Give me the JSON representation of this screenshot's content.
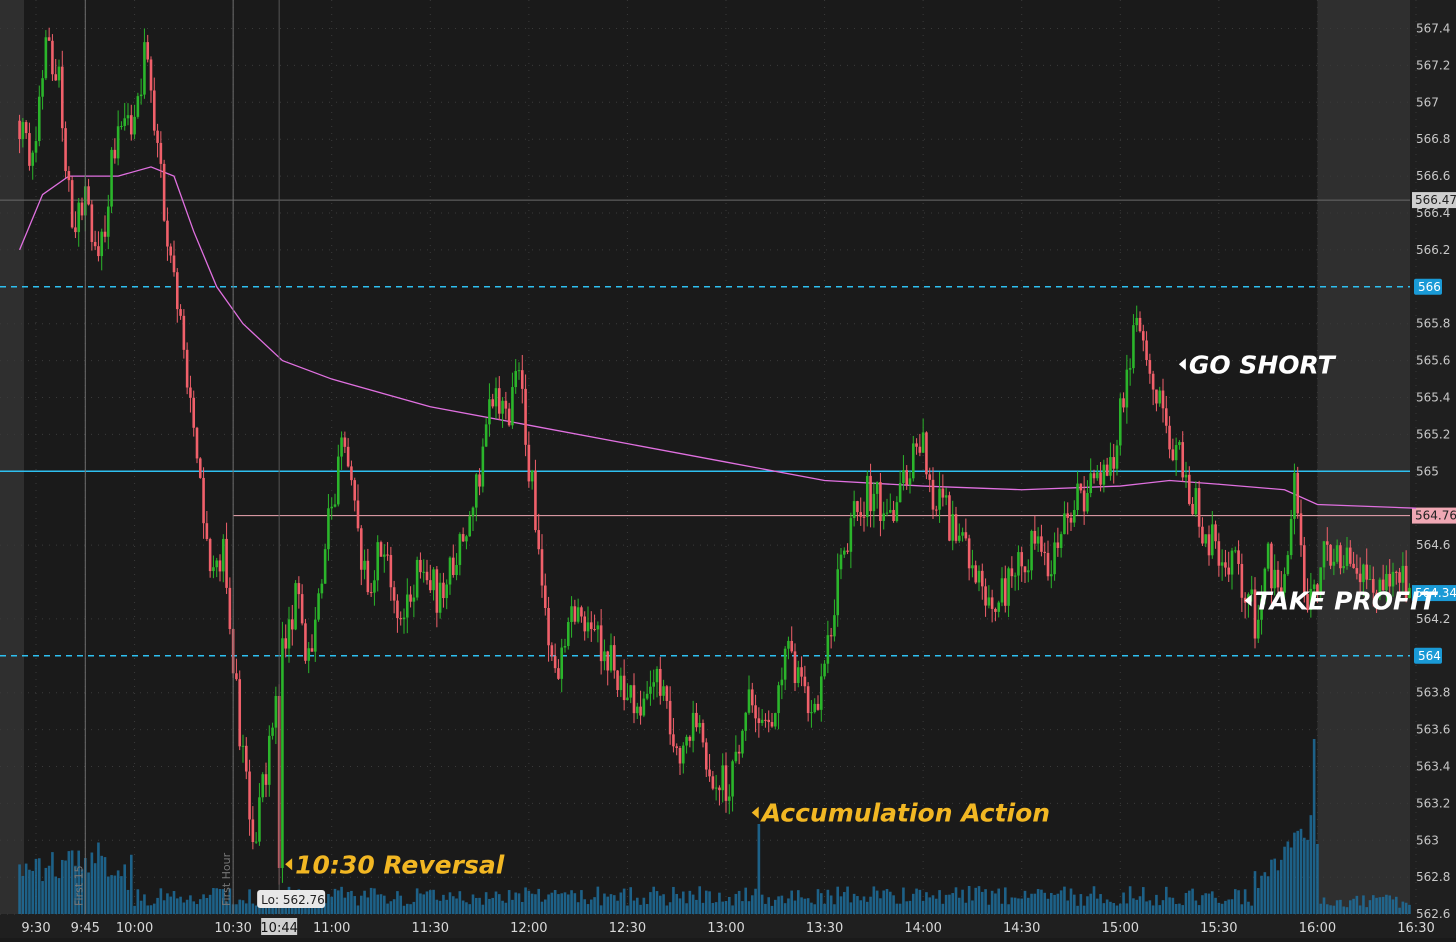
{
  "colors": {
    "background": "#1a1a1a",
    "extended_hours": "#2f2f2f",
    "up_candle": "#2bb52b",
    "down_candle": "#f0606a",
    "volume": "#1e6f9c",
    "vwap": "#e070e0",
    "level_line": "#2ec0f0",
    "annotation_yellow": "#f2b723",
    "annotation_white": "#ffffff",
    "badge_blue": "#1a9ad6",
    "badge_pink": "#f0a8b4",
    "badge_gray": "#cfcfcf"
  },
  "chart_data": {
    "type": "candlestick",
    "x_ticks": [
      "9:30",
      "9:45",
      "10:00",
      "10:30",
      "11:00",
      "11:30",
      "12:00",
      "12:30",
      "13:00",
      "13:30",
      "14:00",
      "14:30",
      "15:00",
      "15:30",
      "16:00",
      "16:30"
    ],
    "y_ticks": [
      "567.4",
      "567.2",
      "567",
      "566.8",
      "566.6",
      "566.4",
      "566.2",
      "565.8",
      "565.6",
      "565.4",
      "565.2",
      "565",
      "564.6",
      "564.2",
      "563.8",
      "563.6",
      "563.4",
      "563.2",
      "563",
      "562.8",
      "562.6"
    ],
    "ylim": [
      562.6,
      567.5
    ],
    "x_range_minutes": [
      560,
      990
    ],
    "session_open": "9:30",
    "session_close": "16:00",
    "price_path": [
      {
        "t": "9:25",
        "p": 566.9
      },
      {
        "t": "9:30",
        "p": 566.7
      },
      {
        "t": "9:34",
        "p": 567.3
      },
      {
        "t": "9:38",
        "p": 567.1
      },
      {
        "t": "9:42",
        "p": 566.3
      },
      {
        "t": "9:46",
        "p": 566.5
      },
      {
        "t": "9:50",
        "p": 566.1
      },
      {
        "t": "9:55",
        "p": 566.8
      },
      {
        "t": "10:00",
        "p": 566.9
      },
      {
        "t": "10:05",
        "p": 567.3
      },
      {
        "t": "10:09",
        "p": 566.6
      },
      {
        "t": "10:14",
        "p": 565.9
      },
      {
        "t": "10:20",
        "p": 565.1
      },
      {
        "t": "10:25",
        "p": 564.4
      },
      {
        "t": "10:28",
        "p": 564.6
      },
      {
        "t": "10:33",
        "p": 563.6
      },
      {
        "t": "10:37",
        "p": 563.0
      },
      {
        "t": "10:41",
        "p": 563.4
      },
      {
        "t": "10:46",
        "p": 564.0
      },
      {
        "t": "10:50",
        "p": 564.3
      },
      {
        "t": "10:54",
        "p": 564.0
      },
      {
        "t": "11:00",
        "p": 564.7
      },
      {
        "t": "11:04",
        "p": 565.1
      },
      {
        "t": "11:08",
        "p": 564.8
      },
      {
        "t": "11:12",
        "p": 564.3
      },
      {
        "t": "11:16",
        "p": 564.6
      },
      {
        "t": "11:22",
        "p": 564.2
      },
      {
        "t": "11:28",
        "p": 564.5
      },
      {
        "t": "11:34",
        "p": 564.3
      },
      {
        "t": "11:40",
        "p": 564.6
      },
      {
        "t": "11:46",
        "p": 565.0
      },
      {
        "t": "11:50",
        "p": 565.4
      },
      {
        "t": "11:54",
        "p": 565.3
      },
      {
        "t": "11:58",
        "p": 565.5
      },
      {
        "t": "12:02",
        "p": 564.9
      },
      {
        "t": "12:06",
        "p": 564.2
      },
      {
        "t": "12:10",
        "p": 563.9
      },
      {
        "t": "12:16",
        "p": 564.3
      },
      {
        "t": "12:22",
        "p": 564.1
      },
      {
        "t": "12:28",
        "p": 563.9
      },
      {
        "t": "12:34",
        "p": 563.7
      },
      {
        "t": "12:40",
        "p": 563.9
      },
      {
        "t": "12:46",
        "p": 563.5
      },
      {
        "t": "12:52",
        "p": 563.6
      },
      {
        "t": "12:56",
        "p": 563.4
      },
      {
        "t": "13:02",
        "p": 563.3
      },
      {
        "t": "13:08",
        "p": 563.8
      },
      {
        "t": "13:14",
        "p": 563.6
      },
      {
        "t": "13:20",
        "p": 564.0
      },
      {
        "t": "13:26",
        "p": 563.7
      },
      {
        "t": "13:30",
        "p": 563.8
      },
      {
        "t": "13:34",
        "p": 564.3
      },
      {
        "t": "13:40",
        "p": 564.8
      },
      {
        "t": "13:46",
        "p": 564.9
      },
      {
        "t": "13:52",
        "p": 564.7
      },
      {
        "t": "13:56",
        "p": 565.0
      },
      {
        "t": "14:00",
        "p": 565.2
      },
      {
        "t": "14:04",
        "p": 564.9
      },
      {
        "t": "14:10",
        "p": 564.7
      },
      {
        "t": "14:16",
        "p": 564.5
      },
      {
        "t": "14:22",
        "p": 564.3
      },
      {
        "t": "14:28",
        "p": 564.4
      },
      {
        "t": "14:34",
        "p": 564.6
      },
      {
        "t": "14:40",
        "p": 564.5
      },
      {
        "t": "14:46",
        "p": 564.8
      },
      {
        "t": "14:52",
        "p": 564.9
      },
      {
        "t": "14:58",
        "p": 565.0
      },
      {
        "t": "15:02",
        "p": 565.4
      },
      {
        "t": "15:06",
        "p": 565.8
      },
      {
        "t": "15:10",
        "p": 565.5
      },
      {
        "t": "15:14",
        "p": 565.3
      },
      {
        "t": "15:18",
        "p": 565.1
      },
      {
        "t": "15:22",
        "p": 564.9
      },
      {
        "t": "15:26",
        "p": 564.7
      },
      {
        "t": "15:30",
        "p": 564.6
      },
      {
        "t": "15:36",
        "p": 564.5
      },
      {
        "t": "15:42",
        "p": 564.2
      },
      {
        "t": "15:46",
        "p": 564.5
      },
      {
        "t": "15:50",
        "p": 564.3
      },
      {
        "t": "15:54",
        "p": 565.0
      },
      {
        "t": "15:58",
        "p": 564.2
      },
      {
        "t": "16:02",
        "p": 564.5
      },
      {
        "t": "16:06",
        "p": 564.6
      },
      {
        "t": "16:12",
        "p": 564.5
      },
      {
        "t": "16:18",
        "p": 564.4
      },
      {
        "t": "16:24",
        "p": 564.5
      },
      {
        "t": "16:28",
        "p": 564.34
      }
    ],
    "vwap": [
      {
        "t": "9:25",
        "p": 566.2
      },
      {
        "t": "9:32",
        "p": 566.5
      },
      {
        "t": "9:40",
        "p": 566.6
      },
      {
        "t": "9:55",
        "p": 566.6
      },
      {
        "t": "10:05",
        "p": 566.65
      },
      {
        "t": "10:12",
        "p": 566.6
      },
      {
        "t": "10:18",
        "p": 566.3
      },
      {
        "t": "10:25",
        "p": 566.0
      },
      {
        "t": "10:33",
        "p": 565.8
      },
      {
        "t": "10:45",
        "p": 565.6
      },
      {
        "t": "11:00",
        "p": 565.5
      },
      {
        "t": "11:30",
        "p": 565.35
      },
      {
        "t": "12:00",
        "p": 565.25
      },
      {
        "t": "12:30",
        "p": 565.15
      },
      {
        "t": "13:00",
        "p": 565.05
      },
      {
        "t": "13:30",
        "p": 564.95
      },
      {
        "t": "14:00",
        "p": 564.92
      },
      {
        "t": "14:30",
        "p": 564.9
      },
      {
        "t": "15:00",
        "p": 564.92
      },
      {
        "t": "15:15",
        "p": 564.95
      },
      {
        "t": "15:30",
        "p": 564.93
      },
      {
        "t": "15:50",
        "p": 564.9
      },
      {
        "t": "16:00",
        "p": 564.82
      },
      {
        "t": "16:30",
        "p": 564.8
      }
    ],
    "levels": [
      {
        "price": 566,
        "style": "dashed",
        "label": "566"
      },
      {
        "price": 565,
        "style": "solid",
        "label": ""
      },
      {
        "price": 564,
        "style": "dashed",
        "label": "564"
      }
    ],
    "reference_lines": [
      {
        "price": 566.47,
        "label": "566.47"
      },
      {
        "price": 564.76,
        "label": "564.76"
      }
    ],
    "last_price": {
      "price": 564.34,
      "label": "564.34"
    },
    "vertical_markers": [
      {
        "t": "9:45",
        "label": "First 15"
      },
      {
        "t": "10:30",
        "label": "First Hour"
      }
    ],
    "low_marker": {
      "t": "10:44",
      "label": "Lo: 562.76",
      "time_label": "10:44"
    },
    "annotations": [
      {
        "t": "10:44",
        "p": 562.87,
        "text": "10:30 Reversal",
        "color": "yellow"
      },
      {
        "t": "13:06",
        "p": 563.15,
        "text": "Accumulation Action",
        "color": "yellow"
      },
      {
        "t": "15:16",
        "p": 565.58,
        "text": "GO SHORT",
        "color": "white"
      },
      {
        "t": "15:36",
        "p": 564.3,
        "text": "TAKE PROFIT",
        "color": "white"
      }
    ]
  }
}
